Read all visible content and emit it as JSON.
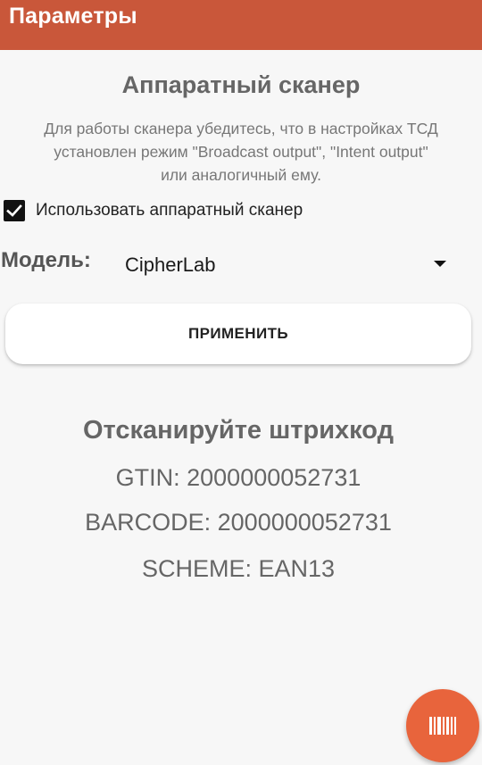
{
  "app_bar": {
    "title": "Параметры"
  },
  "scanner_section": {
    "title": "Аппаратный сканер",
    "description_lines": [
      "Для работы сканера убедитесь, что в настройках ТСД",
      "установлен режим \"Broadcast output\", \"Intent output\"",
      "или аналогичный ему."
    ],
    "use_hardware_scanner": {
      "label": "Использовать аппаратный сканер",
      "checked": true
    },
    "model": {
      "label": "Модель:",
      "selected": "CipherLab"
    },
    "apply_label": "ПРИМЕНИТЬ"
  },
  "scan_result": {
    "title": "Отсканируйте штрихкод",
    "gtin": "GTIN: 2000000052731",
    "barcode": "BARCODE: 2000000052731",
    "scheme": "SCHEME: EAN13"
  },
  "fab": {
    "icon": "barcode-icon"
  },
  "colors": {
    "app_bar": "#c9573a",
    "fab": "#e8643c",
    "background": "#f7f7f7"
  }
}
